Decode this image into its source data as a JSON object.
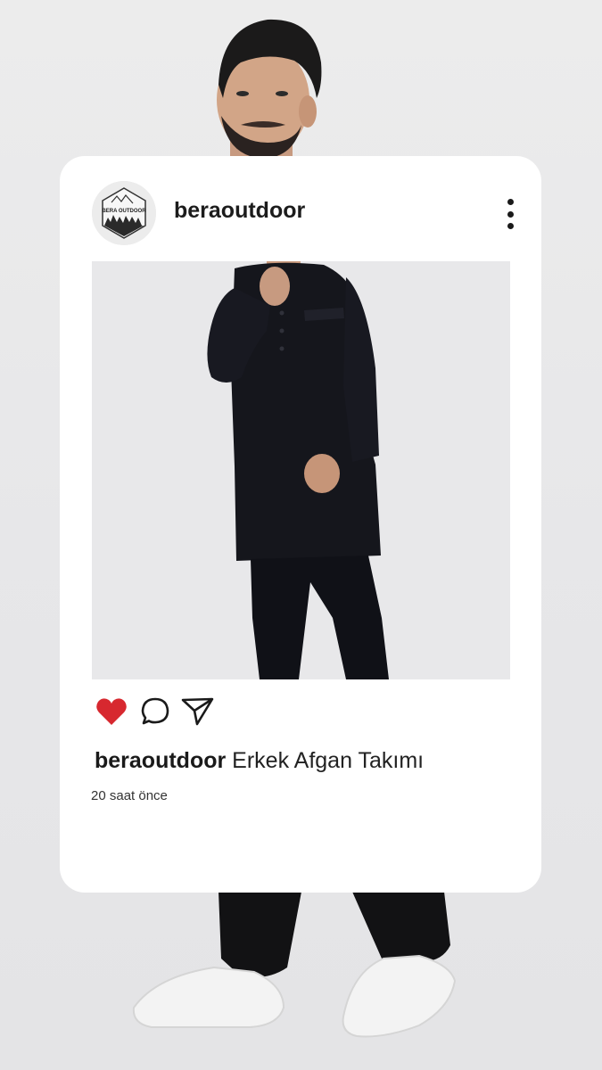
{
  "post": {
    "username": "beraoutdoor",
    "avatar_text": "BERA OUTDOOR",
    "caption_user": "beraoutdoor",
    "caption_text": "Erkek Afgan Takımı",
    "timestamp": "20 saat önce",
    "liked": true,
    "icons": {
      "like": "heart-icon",
      "comment": "comment-icon",
      "share": "send-icon",
      "menu": "more-vertical-icon"
    }
  },
  "colors": {
    "card_background": "#ffffff",
    "like_red": "#d7282f",
    "text": "#1a1a1a",
    "outfit": "#15161c"
  }
}
